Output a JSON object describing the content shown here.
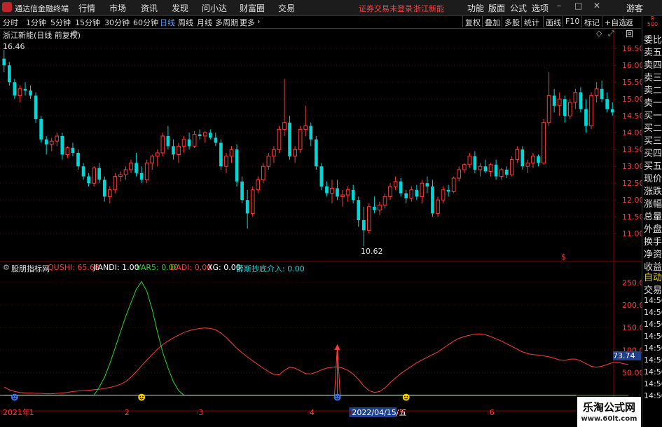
{
  "app": {
    "title": "通达信金融终端",
    "menu": [
      "行情",
      "市场",
      "资讯",
      "发现",
      "问小达",
      "财富圈",
      "交易"
    ],
    "status": "证券交易未登录",
    "stock_name": "浙江新能",
    "right_menu": [
      "功能",
      "版面",
      "公式",
      "选项"
    ],
    "user": "游客",
    "win_buttons": [
      "–",
      "□",
      "✕"
    ]
  },
  "toolbar": {
    "periods": [
      "分时",
      "1分钟",
      "5分钟",
      "15分钟",
      "30分钟",
      "60分钟",
      "日线",
      "周线",
      "月线",
      "多周期",
      "更多"
    ],
    "active_period": "日线",
    "more_arrow": "›",
    "right_buttons": [
      "复权",
      "叠加",
      "多股",
      "统计",
      "画线",
      "F10",
      "标记",
      "+自选",
      "返回"
    ]
  },
  "main_chart": {
    "title": "浙江新能(日线 前复权)",
    "high_label": "16.46",
    "low_label": "10.62",
    "marker": "$"
  },
  "indicator": {
    "name": "股朋指标网",
    "values": [
      {
        "label": "QUSHI: 65.68",
        "color": "#ff3c3c"
      },
      {
        "label": "JIANDI: 1.00",
        "color": "#ffffff"
      },
      {
        "label": "VAR5: 0.00",
        "color": "#22dd22"
      },
      {
        "label": "DADI: 0.00",
        "color": "#ff3c3c"
      },
      {
        "label": "XG: 0.00",
        "color": "#ffffff"
      },
      {
        "label": "薛斯抄底介入: 0.00",
        "color": "#22d3d3"
      }
    ],
    "current_value": "73.74"
  },
  "right_panel": {
    "badge": "R\n500",
    "labels": [
      "委比",
      "卖五",
      "卖四",
      "卖三",
      "卖二",
      "卖一",
      "买一",
      "买二",
      "买三",
      "买四",
      "买五",
      "现价",
      "涨跌",
      "涨幅",
      "总量",
      "外盘",
      "换手",
      "净资",
      "收益"
    ],
    "auto_label": "自动",
    "trade_label": "交易",
    "times": [
      "14:56",
      "14:56",
      "14:56",
      "14:56",
      "14:56",
      "14:56",
      "14:56",
      "14:56",
      "14:56"
    ]
  },
  "watermark": {
    "line1": "乐淘公式网",
    "line2": "www.60lt.com"
  },
  "colors": {
    "up": "#ff3c3c",
    "down": "#00d8d8",
    "grid": "#8b0000",
    "active": "#5b9dff"
  },
  "chart_data": {
    "type": "candlestick",
    "price_axis": {
      "ticks": [
        "16.50",
        "16.00",
        "15.50",
        "15.00",
        "14.50",
        "14.00",
        "13.50",
        "13.00",
        "12.50",
        "12.00",
        "11.50",
        "11.00"
      ],
      "ylim": [
        10.4,
        16.9
      ]
    },
    "indicator_axis": {
      "ticks": [
        "250.0",
        "200.0",
        "150.0",
        "100.0",
        "50.00"
      ],
      "ylim": [
        -10,
        270
      ]
    },
    "x_labels": [
      {
        "label": "2021年",
        "at": 0
      },
      {
        "label": "1",
        "at": 5
      },
      {
        "label": "2",
        "at": 23
      },
      {
        "label": "3",
        "at": 37
      },
      {
        "label": "4",
        "at": 58
      },
      {
        "label": "2022/04/15/五",
        "at": 66
      },
      {
        "label": "5",
        "at": 75
      },
      {
        "label": "6",
        "at": 92
      },
      {
        "label": "7",
        "at": 111
      }
    ],
    "ohlc": [
      [
        16.2,
        16.46,
        15.8,
        16.0
      ],
      [
        16.0,
        16.1,
        15.4,
        15.5
      ],
      [
        15.5,
        15.6,
        15.0,
        15.1
      ],
      [
        15.1,
        15.4,
        14.9,
        15.3
      ],
      [
        15.3,
        15.5,
        15.1,
        15.25
      ],
      [
        15.25,
        15.4,
        15.0,
        15.1
      ],
      [
        15.1,
        15.2,
        14.3,
        14.4
      ],
      [
        14.4,
        14.5,
        13.7,
        13.8
      ],
      [
        13.8,
        13.9,
        13.35,
        13.65
      ],
      [
        13.65,
        13.85,
        13.45,
        13.75
      ],
      [
        13.75,
        14.0,
        13.6,
        13.9
      ],
      [
        13.9,
        14.0,
        13.2,
        13.35
      ],
      [
        13.35,
        13.6,
        13.25,
        13.55
      ],
      [
        13.55,
        13.7,
        13.3,
        13.4
      ],
      [
        13.4,
        13.5,
        12.9,
        13.0
      ],
      [
        13.0,
        13.1,
        12.6,
        12.7
      ],
      [
        12.7,
        12.8,
        12.4,
        12.5
      ],
      [
        12.5,
        13.0,
        12.4,
        12.95
      ],
      [
        12.95,
        13.1,
        12.5,
        12.6
      ],
      [
        12.6,
        12.7,
        11.95,
        12.1
      ],
      [
        12.1,
        12.4,
        11.9,
        12.3
      ],
      [
        12.3,
        12.8,
        12.2,
        12.7
      ],
      [
        12.7,
        12.85,
        12.55,
        12.75
      ],
      [
        12.75,
        13.0,
        12.6,
        12.9
      ],
      [
        12.9,
        13.2,
        12.8,
        13.1
      ],
      [
        13.1,
        13.4,
        12.7,
        12.8
      ],
      [
        12.8,
        13.0,
        12.5,
        12.6
      ],
      [
        12.6,
        13.2,
        12.5,
        13.1
      ],
      [
        13.1,
        13.35,
        12.9,
        13.3
      ],
      [
        13.3,
        13.5,
        13.0,
        13.4
      ],
      [
        13.4,
        14.0,
        13.3,
        13.9
      ],
      [
        13.9,
        14.2,
        13.5,
        13.6
      ],
      [
        13.6,
        13.8,
        13.2,
        13.35
      ],
      [
        13.35,
        13.7,
        13.1,
        13.6
      ],
      [
        13.6,
        13.9,
        13.4,
        13.8
      ],
      [
        13.8,
        14.0,
        13.5,
        13.6
      ],
      [
        13.6,
        14.05,
        13.55,
        13.95
      ],
      [
        13.95,
        14.1,
        13.8,
        13.9
      ],
      [
        13.9,
        14.05,
        13.7,
        14.0
      ],
      [
        14.0,
        14.1,
        13.8,
        13.85
      ],
      [
        13.85,
        14.0,
        13.6,
        13.7
      ],
      [
        13.7,
        13.8,
        12.9,
        13.0
      ],
      [
        13.0,
        13.4,
        12.8,
        13.3
      ],
      [
        13.3,
        13.6,
        13.1,
        13.5
      ],
      [
        13.5,
        13.65,
        12.4,
        12.55
      ],
      [
        12.55,
        12.7,
        11.9,
        12.0
      ],
      [
        12.0,
        12.3,
        11.15,
        11.6
      ],
      [
        11.6,
        12.4,
        11.5,
        12.3
      ],
      [
        12.3,
        12.7,
        12.2,
        12.6
      ],
      [
        12.6,
        13.1,
        12.5,
        13.0
      ],
      [
        13.0,
        13.4,
        12.9,
        13.3
      ],
      [
        13.3,
        13.6,
        13.1,
        13.5
      ],
      [
        13.5,
        14.2,
        13.4,
        14.1
      ],
      [
        14.1,
        15.6,
        13.9,
        14.3
      ],
      [
        14.3,
        14.5,
        13.2,
        13.3
      ],
      [
        13.3,
        13.6,
        13.1,
        13.5
      ],
      [
        13.5,
        14.2,
        13.4,
        14.1
      ],
      [
        14.1,
        14.8,
        13.9,
        14.2
      ],
      [
        14.2,
        14.3,
        13.6,
        13.8
      ],
      [
        13.8,
        13.9,
        12.9,
        13.0
      ],
      [
        13.0,
        13.1,
        12.3,
        12.4
      ],
      [
        12.4,
        12.55,
        12.1,
        12.2
      ],
      [
        12.2,
        12.6,
        11.9,
        12.35
      ],
      [
        12.35,
        12.6,
        12.0,
        12.1
      ],
      [
        12.1,
        12.3,
        11.8,
        12.15
      ],
      [
        12.15,
        12.4,
        11.95,
        12.3
      ],
      [
        12.3,
        12.45,
        11.9,
        12.0
      ],
      [
        12.0,
        12.1,
        11.2,
        11.4
      ],
      [
        11.4,
        11.8,
        10.62,
        11.1
      ],
      [
        11.1,
        11.9,
        11.0,
        11.8
      ],
      [
        11.8,
        12.1,
        11.6,
        11.7
      ],
      [
        11.7,
        11.95,
        11.55,
        11.85
      ],
      [
        11.85,
        12.2,
        11.75,
        12.1
      ],
      [
        12.1,
        12.5,
        12.0,
        12.4
      ],
      [
        12.4,
        12.7,
        12.3,
        12.55
      ],
      [
        12.55,
        12.65,
        12.1,
        12.2
      ],
      [
        12.2,
        12.3,
        11.9,
        12.05
      ],
      [
        12.05,
        12.4,
        11.95,
        12.3
      ],
      [
        12.3,
        12.45,
        12.0,
        12.1
      ],
      [
        12.1,
        12.6,
        11.9,
        12.5
      ],
      [
        12.5,
        12.7,
        12.2,
        12.4
      ],
      [
        12.4,
        12.6,
        11.5,
        11.6
      ],
      [
        11.6,
        12.1,
        11.5,
        12.0
      ],
      [
        12.0,
        12.4,
        11.9,
        12.3
      ],
      [
        12.3,
        12.45,
        12.1,
        12.25
      ],
      [
        12.25,
        12.7,
        12.2,
        12.65
      ],
      [
        12.65,
        13.0,
        12.55,
        12.9
      ],
      [
        12.9,
        13.1,
        12.8,
        13.05
      ],
      [
        13.05,
        13.4,
        12.95,
        13.3
      ],
      [
        13.3,
        13.45,
        12.8,
        12.9
      ],
      [
        12.9,
        13.1,
        12.7,
        13.0
      ],
      [
        13.0,
        13.2,
        12.8,
        12.85
      ],
      [
        12.85,
        13.1,
        12.7,
        13.05
      ],
      [
        13.05,
        13.2,
        12.6,
        12.7
      ],
      [
        12.7,
        12.95,
        12.6,
        12.9
      ],
      [
        12.9,
        13.0,
        12.65,
        12.75
      ],
      [
        12.75,
        13.3,
        12.7,
        13.2
      ],
      [
        13.2,
        13.6,
        13.1,
        13.5
      ],
      [
        13.5,
        13.6,
        12.9,
        13.0
      ],
      [
        13.0,
        13.2,
        12.8,
        13.1
      ],
      [
        13.1,
        13.4,
        12.95,
        13.3
      ],
      [
        13.3,
        13.35,
        13.0,
        13.1
      ],
      [
        13.1,
        14.4,
        13.05,
        14.3
      ],
      [
        14.3,
        15.8,
        14.2,
        15.1
      ],
      [
        15.1,
        15.3,
        14.6,
        14.8
      ],
      [
        14.8,
        15.2,
        14.5,
        15.0
      ],
      [
        15.0,
        15.1,
        14.3,
        14.5
      ],
      [
        14.5,
        15.0,
        14.4,
        14.9
      ],
      [
        14.9,
        15.3,
        14.7,
        15.2
      ],
      [
        15.2,
        15.35,
        14.6,
        14.7
      ],
      [
        14.7,
        15.0,
        14.0,
        14.2
      ],
      [
        14.2,
        15.2,
        14.1,
        15.1
      ],
      [
        15.1,
        15.5,
        14.9,
        15.3
      ],
      [
        15.3,
        15.55,
        14.9,
        15.0
      ],
      [
        15.0,
        15.2,
        14.6,
        14.7
      ],
      [
        14.7,
        14.9,
        14.5,
        14.6
      ]
    ],
    "series": [
      {
        "name": "QUSHI",
        "color": "#ff3c3c",
        "values": [
          18,
          12,
          8,
          6,
          5,
          5,
          4,
          4,
          3,
          3,
          4,
          5,
          6,
          8,
          9,
          10,
          11,
          12,
          13,
          15,
          17,
          20,
          24,
          30,
          40,
          52,
          65,
          78,
          90,
          102,
          112,
          120,
          127,
          133,
          139,
          143,
          146,
          148,
          149,
          148,
          145,
          138,
          128,
          116,
          104,
          94,
          85,
          76,
          68,
          60,
          52,
          46,
          45,
          55,
          62,
          60,
          54,
          48,
          47,
          51,
          56,
          60,
          62,
          63,
          60,
          55,
          47,
          35,
          20,
          10,
          6,
          8,
          16,
          28,
          38,
          48,
          56,
          64,
          72,
          78,
          84,
          90,
          96,
          104,
          112,
          120,
          126,
          130,
          133,
          135,
          136,
          134,
          130,
          125,
          120,
          114,
          108,
          102,
          96,
          92,
          90,
          89,
          87,
          85,
          82,
          78,
          77,
          80,
          80,
          76,
          70,
          64,
          62,
          64,
          68,
          72,
          73,
          70,
          68
        ]
      },
      {
        "name": "VAR5",
        "color": "#22dd22",
        "values": [
          0,
          0,
          0,
          0,
          0,
          0,
          0,
          0,
          0,
          0,
          0,
          0,
          0,
          0,
          0,
          0,
          0,
          0,
          18,
          40,
          70,
          105,
          140,
          175,
          205,
          235,
          252,
          230,
          190,
          140,
          95,
          60,
          30,
          10,
          0,
          0,
          0,
          0,
          0,
          0,
          0,
          0,
          0,
          0,
          0,
          0,
          0,
          0,
          0,
          0,
          0,
          0,
          0,
          0,
          0,
          0,
          0,
          0,
          0,
          0,
          0,
          0,
          0,
          0,
          0,
          0,
          0,
          0,
          0,
          0,
          0,
          0,
          0,
          0,
          0,
          0,
          0,
          0,
          0,
          0,
          0,
          0,
          0,
          0,
          0,
          0,
          0,
          0,
          0,
          0,
          0,
          0,
          0,
          0,
          0,
          0,
          0,
          0,
          0,
          0,
          0,
          0,
          0,
          0,
          0,
          0,
          0,
          0,
          0,
          0,
          0,
          0,
          0,
          0,
          0,
          0,
          0,
          0,
          0
        ]
      },
      {
        "name": "DADI",
        "color": "#ff3c3c",
        "spikes": [
          {
            "at": 63,
            "value": 110
          }
        ]
      }
    ]
  }
}
